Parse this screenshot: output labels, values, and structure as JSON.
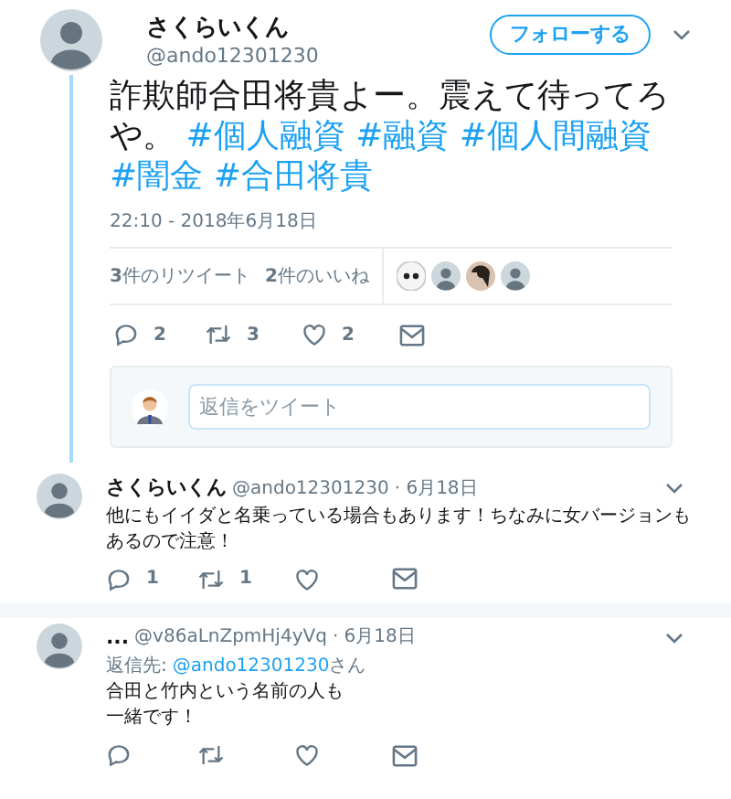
{
  "main_tweet": {
    "name": "さくらいくん",
    "handle": "@ando12301230",
    "follow_button": "フォローする",
    "text": "詐欺師合田将貴よー。震えて待ってろや。",
    "hashtags": [
      "#個人融資",
      "#融資",
      "#個人間融資",
      "#闇金",
      "#合田将貴"
    ],
    "timestamp": "22:10 - 2018年6月18日",
    "retweets": "**3**件のリツイート",
    "likes": "**2**件のいいね",
    "likers": [
      {
        "kind": "cartoon"
      },
      {
        "kind": "default"
      },
      {
        "kind": "photo"
      },
      {
        "kind": "default"
      }
    ],
    "actions": {
      "reply_count": "2",
      "retweet_count": "3",
      "like_count": "2"
    }
  },
  "reply_box": {
    "placeholder": "返信をツイート"
  },
  "replies": [
    {
      "name": "さくらいくん",
      "handle": "@ando12301230",
      "date": "· 6月18日",
      "text_lines": [
        "他にもイイダと名乗っている場合もあります！ちなみに女バージョンもあるので注意！"
      ],
      "reply_count": "1",
      "retweet_count": "1",
      "threaded": true
    },
    {
      "name": "...",
      "handle": "@v86aLnZpmHj4yVq",
      "date": "· 6月18日",
      "reply_to_label": "返信先:",
      "reply_to": "@ando12301230",
      "reply_to_suffix": "さん",
      "text_lines": [
        "合田と竹内という名前の人も",
        "一緒です！"
      ],
      "threaded": false
    }
  ]
}
